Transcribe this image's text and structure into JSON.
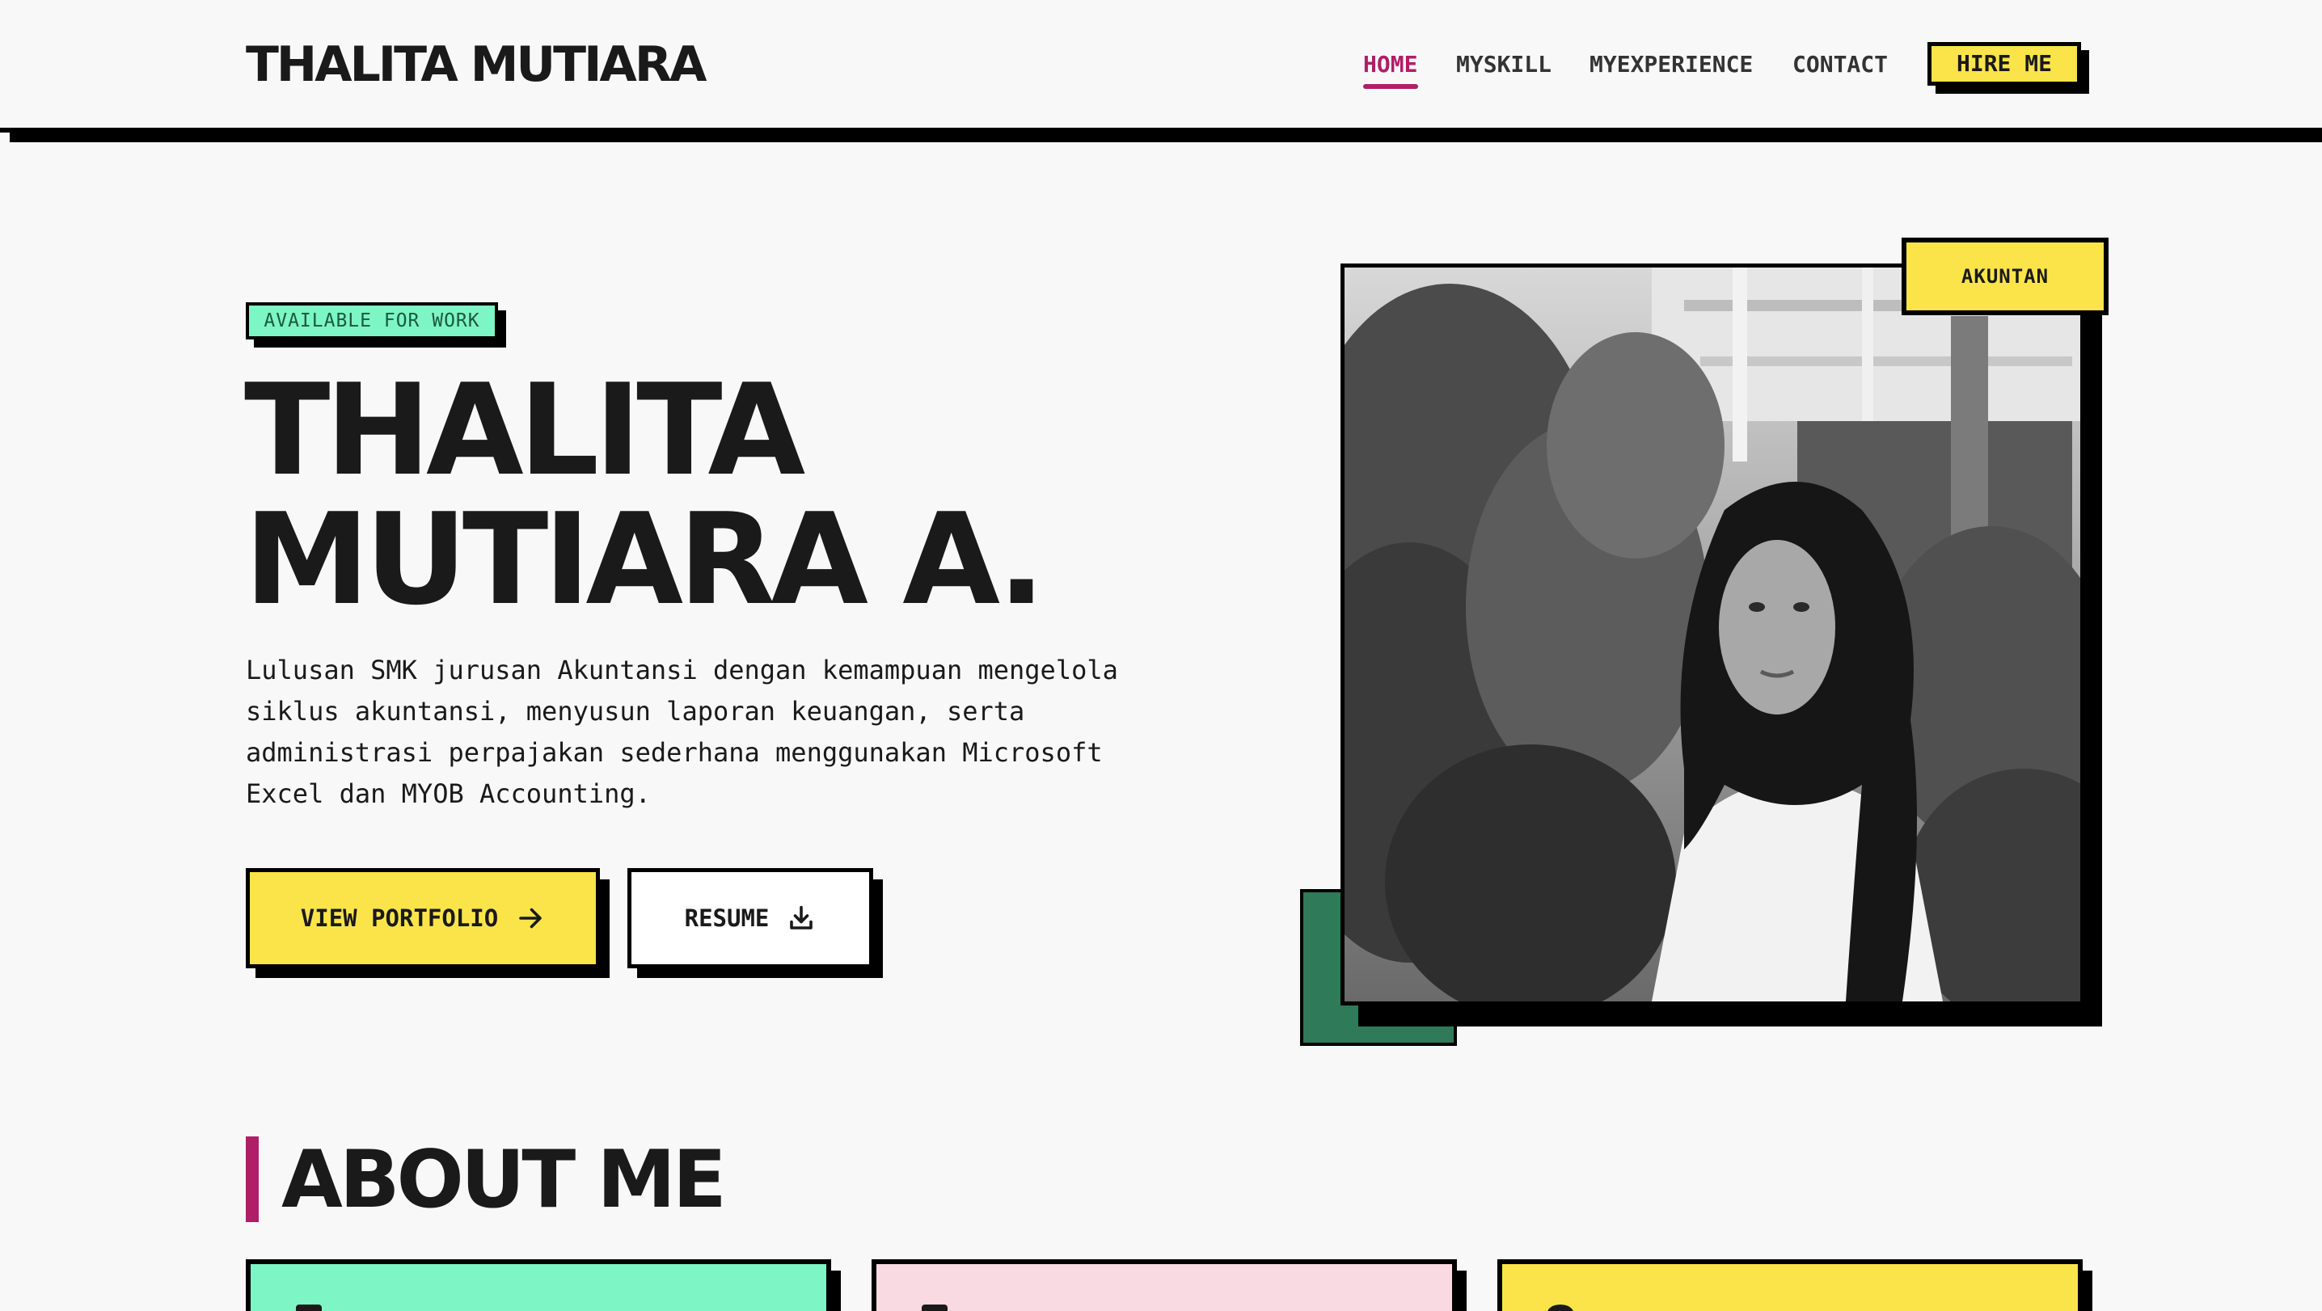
{
  "header": {
    "logo": "THALITA MUTIARA",
    "nav": [
      "HOME",
      "MYSKILL",
      "MYEXPERIENCE",
      "CONTACT"
    ],
    "active_nav": "HOME",
    "hire_button": "HIRE ME"
  },
  "hero": {
    "badge": "AVAILABLE FOR WORK",
    "title_line1": "THALITA",
    "title_line2": "MUTIARA A.",
    "description": "Lulusan SMK jurusan Akuntansi dengan kemampuan mengelola siklus akuntansi, menyusun laporan keuangan, serta administrasi perpajakan sederhana menggunakan Microsoft Excel dan MYOB Accounting.",
    "primary_button": "VIEW PORTFOLIO",
    "secondary_button": "RESUME",
    "photo_tag": "AKUNTAN"
  },
  "about": {
    "title": "ABOUT ME",
    "cards": [
      {
        "color": "#7ef5c5",
        "icon": "card-icon"
      },
      {
        "color": "#f9d9e2",
        "icon": "card-icon"
      },
      {
        "color": "#fbe44a",
        "icon": "card-icon"
      }
    ]
  },
  "colors": {
    "accent": "#b01e68",
    "yellow": "#fbe44a",
    "mint": "#7ef5c5",
    "green": "#2f7a58",
    "pink": "#f9d9e2"
  }
}
